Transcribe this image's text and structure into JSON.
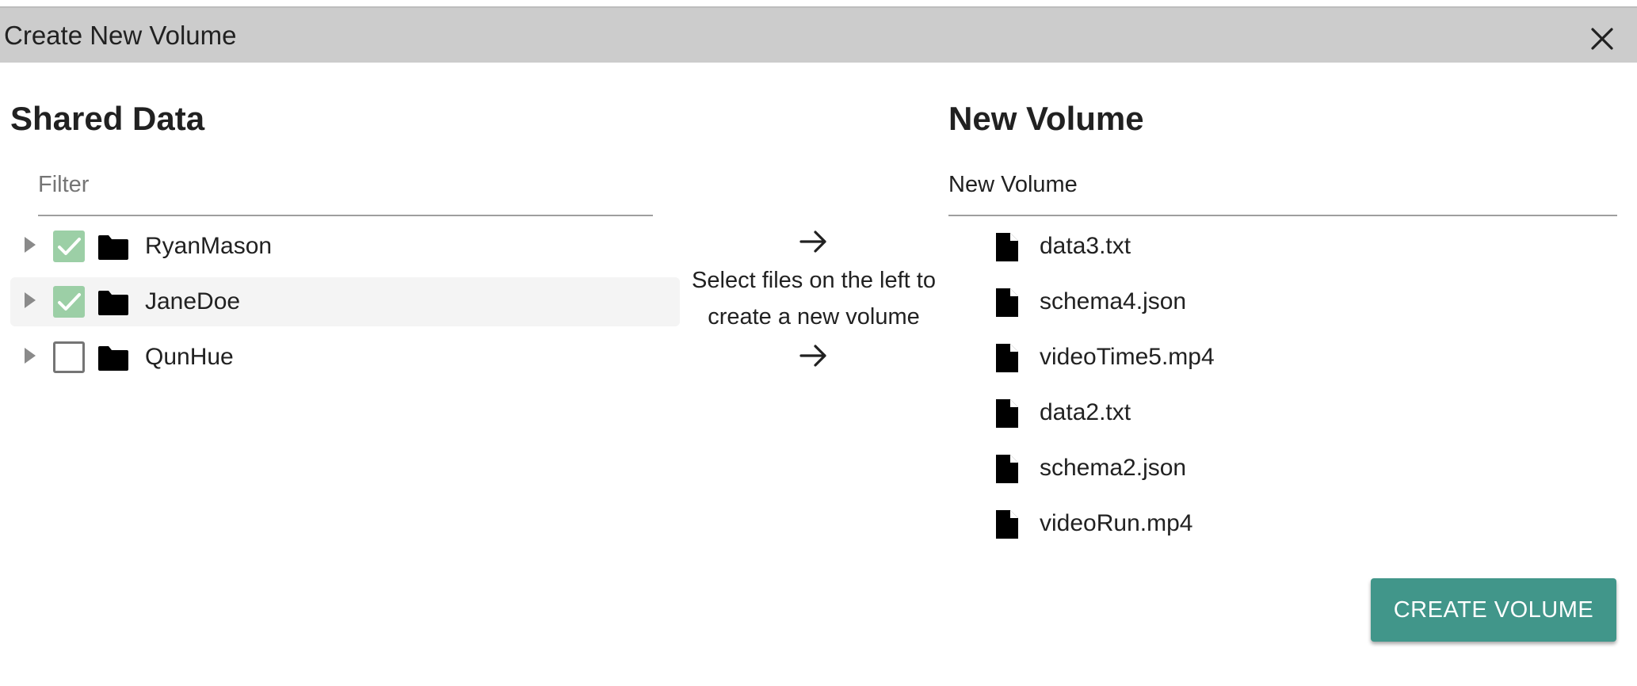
{
  "dialog": {
    "title": "Create New Volume"
  },
  "left_panel": {
    "heading": "Shared Data",
    "filter_placeholder": "Filter",
    "tree": [
      {
        "label": "RyanMason",
        "checked": true
      },
      {
        "label": "JaneDoe",
        "checked": true
      },
      {
        "label": "QunHue",
        "checked": false
      }
    ]
  },
  "middle": {
    "message": "Select files on the left to create a new volume"
  },
  "right_panel": {
    "heading": "New Volume",
    "volume_name_value": "New Volume",
    "files": [
      {
        "name": "data3.txt"
      },
      {
        "name": "schema4.json"
      },
      {
        "name": "videoTime5.mp4"
      },
      {
        "name": "data2.txt"
      },
      {
        "name": "schema2.json"
      },
      {
        "name": "videoRun.mp4"
      }
    ],
    "create_label": "CREATE VOLUME"
  },
  "colors": {
    "title_bar": "#cccccc",
    "checkbox_checked": "#9ccfa6",
    "primary_button": "#41968a"
  }
}
